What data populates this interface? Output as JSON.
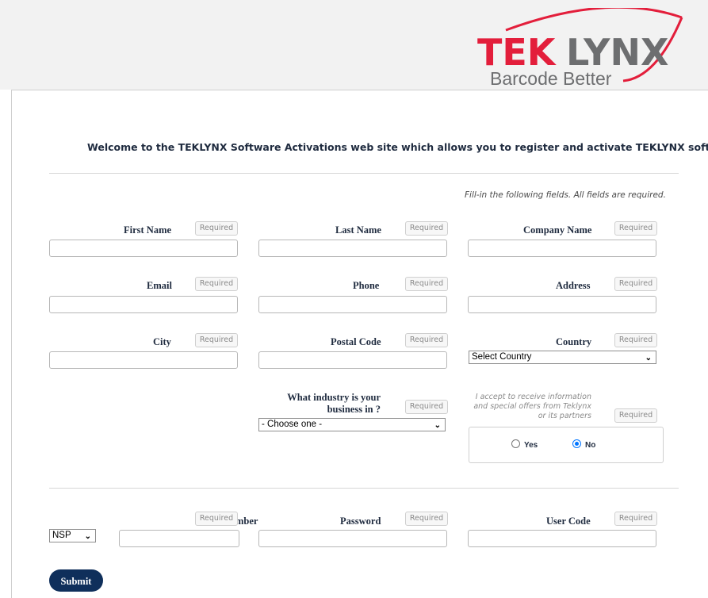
{
  "brand": {
    "name": "TEKLYNX",
    "name_part_red": "TEK",
    "name_part_gray": "LYNX",
    "tagline": "Barcode Better",
    "colors": {
      "red": "#e31e3b",
      "gray": "#6d6e70",
      "navy": "#0f2f5b"
    }
  },
  "welcome_text": "Welcome to the TEKLYNX Software Activations web site which allows you to register and activate TEKLYNX software.",
  "fill_note": "Fill-in the following fields. All fields are required.",
  "required_badge": "Required",
  "fields": {
    "first_name": "First Name",
    "last_name": "Last Name",
    "company_name": "Company Name",
    "email": "Email",
    "phone": "Phone",
    "address": "Address",
    "city": "City",
    "postal_code": "Postal Code",
    "country": "Country",
    "industry_line1": "What industry is your",
    "industry_line2": "business in ?",
    "password": "Password",
    "user_code": "User Code",
    "number_partial": "mber"
  },
  "selects": {
    "country_value": "Select Country",
    "industry_value": "- Choose one -",
    "prefix_value": "NSP"
  },
  "consent": {
    "line1": "I accept to receive information",
    "line2": "and special offers from Teklynx",
    "line3": "or its partners",
    "yes": "Yes",
    "no": "No",
    "selected": "No"
  },
  "submit_label": "Submit"
}
